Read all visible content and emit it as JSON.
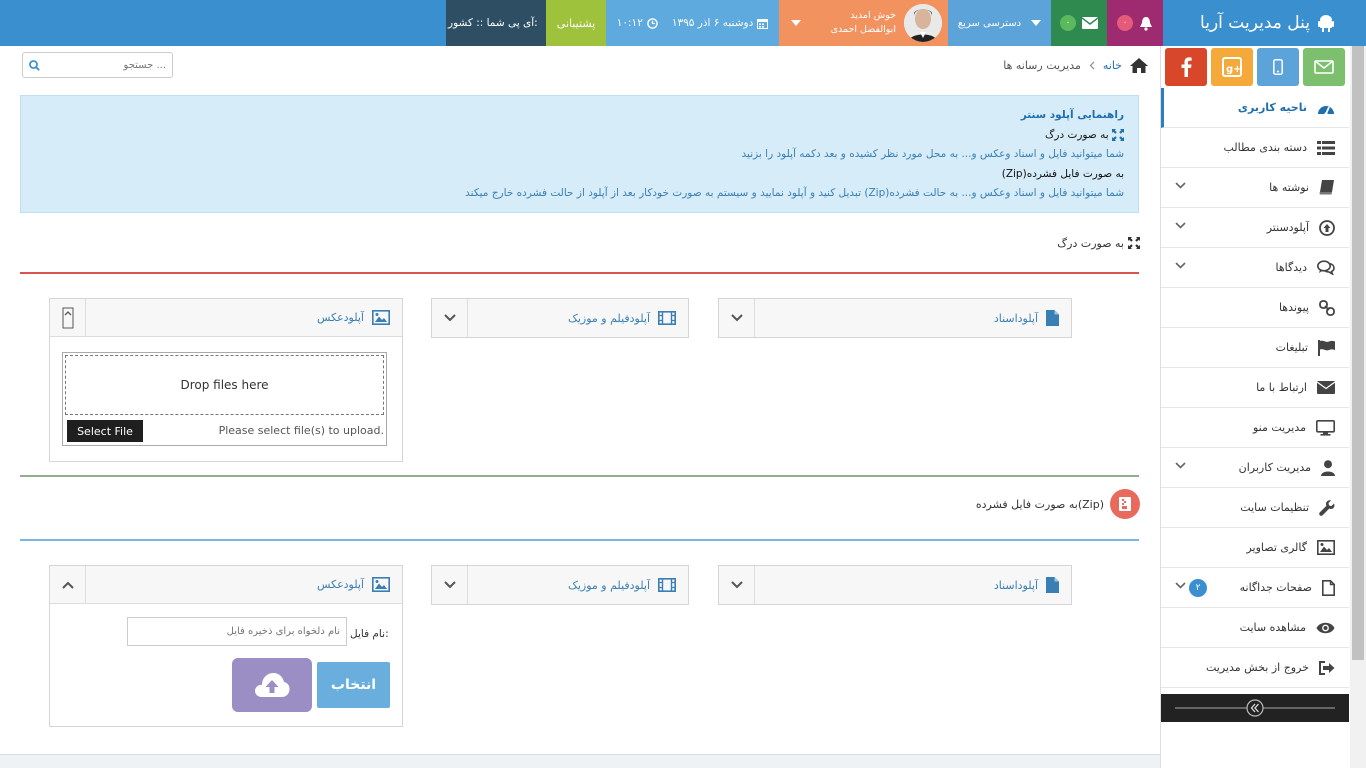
{
  "topbar": {
    "brand": "پنل مدیریت آریا",
    "bell_count": "۰",
    "mail_count": "۰",
    "quick_access": "دسترسی سریع",
    "welcome": "خوش امدید",
    "user_name": "ابوالفضل احمدی",
    "date": "دوشنبه ۶ اذر ۱۳۹۵",
    "time": "۱۰:۱۲",
    "support": "پشتیبانی",
    "ip": "آی پی شما :: کشور:"
  },
  "breadcrumb": {
    "home": "خانه",
    "current": "مدیریت رسانه ها"
  },
  "search": {
    "placeholder": "جستجو ..."
  },
  "help": {
    "title": "راهنمایی آپلود سنتر",
    "drag_title": "به صورت درگ",
    "drag_text": "شما میتوانید فایل و اسناد وعکس و... به محل مورد نظر کشیده و بعد دکمه آپلود را بزنید",
    "zip_title": "به صورت فایل فشرده(Zip)",
    "zip_text": "شما میتوانید فایل و اسناد وعکس و... به حالت فشرده(Zip) تبدیل کنید و آپلود نمایید و سیستم به صورت خودکار بعد از آپلود از حالت فشرده خارج میکند"
  },
  "drag_section": {
    "heading": "به صورت درگ",
    "panels": {
      "image": "آپلودعکس",
      "video": "آپلودفیلم و موزیک",
      "doc": "آپلوداسناد"
    },
    "drop_text": "Drop files here",
    "select_button": "Select File",
    "select_hint": "Please select file(s) to upload."
  },
  "zip_section": {
    "heading": "به صورت فایل فشرده(Zip)",
    "panels": {
      "image": "آپلودعکس",
      "video": "آپلودفیلم و موزیک",
      "doc": "آپلوداسناد"
    },
    "file_name_label": "نام فایل:",
    "file_name_placeholder": "نام دلخواه برای ذخیره فایل",
    "choose_button": "انتخاب"
  },
  "sidebar": {
    "items": [
      {
        "label": "ناحیه کاربری",
        "icon": "dashboard-icon"
      },
      {
        "label": "دسته بندی مطالب",
        "icon": "list-icon"
      },
      {
        "label": "نوشته ها",
        "icon": "book-icon"
      },
      {
        "label": "آپلودسنتر",
        "icon": "upload-icon"
      },
      {
        "label": "دیدگاها",
        "icon": "comments-icon"
      },
      {
        "label": "پیوندها",
        "icon": "link-icon"
      },
      {
        "label": "تبلیغات",
        "icon": "flag-icon"
      },
      {
        "label": "ارتباط با ما",
        "icon": "envelope-icon"
      },
      {
        "label": "مدیریت منو",
        "icon": "monitor-icon"
      },
      {
        "label": "مدیریت کاربران",
        "icon": "user-icon"
      },
      {
        "label": "تنظیمات سایت",
        "icon": "wrench-icon"
      },
      {
        "label": "گالری تصاویر",
        "icon": "picture-icon"
      },
      {
        "label": "صفحات جداگانه",
        "icon": "file-icon",
        "count": "۲"
      },
      {
        "label": "مشاهده سایت",
        "icon": "eye-icon"
      },
      {
        "label": "خروج از بخش مدیریت",
        "icon": "signout-icon"
      }
    ]
  },
  "colors": {
    "topbar": "#3a8fce",
    "bell": "#9e2b6f",
    "mail": "#2f8a4f",
    "user": "#f2925e",
    "support": "#9ec23c",
    "ip": "#2e4f63",
    "facebook": "#d9472b",
    "gplus": "#f4a93a",
    "mobile": "#5ba3d8",
    "email": "#7cbf6e",
    "help_bg": "#d6ecf8"
  }
}
